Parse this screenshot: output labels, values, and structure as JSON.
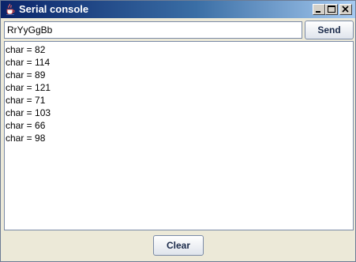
{
  "window": {
    "title": "Serial console",
    "icons": {
      "app": "java-cup-icon",
      "minimize": "minimize-icon",
      "maximize": "maximize-icon",
      "close": "close-icon"
    },
    "colors": {
      "titlebar_start": "#0a246a",
      "titlebar_end": "#a6caf0",
      "background": "#ece9d8"
    }
  },
  "input": {
    "value": "RrYyGgBb"
  },
  "buttons": {
    "send": "Send",
    "clear": "Clear"
  },
  "log": [
    "char = 82",
    "char = 114",
    "char = 89",
    "char = 121",
    "char = 71",
    "char = 103",
    "char = 66",
    "char = 98"
  ]
}
